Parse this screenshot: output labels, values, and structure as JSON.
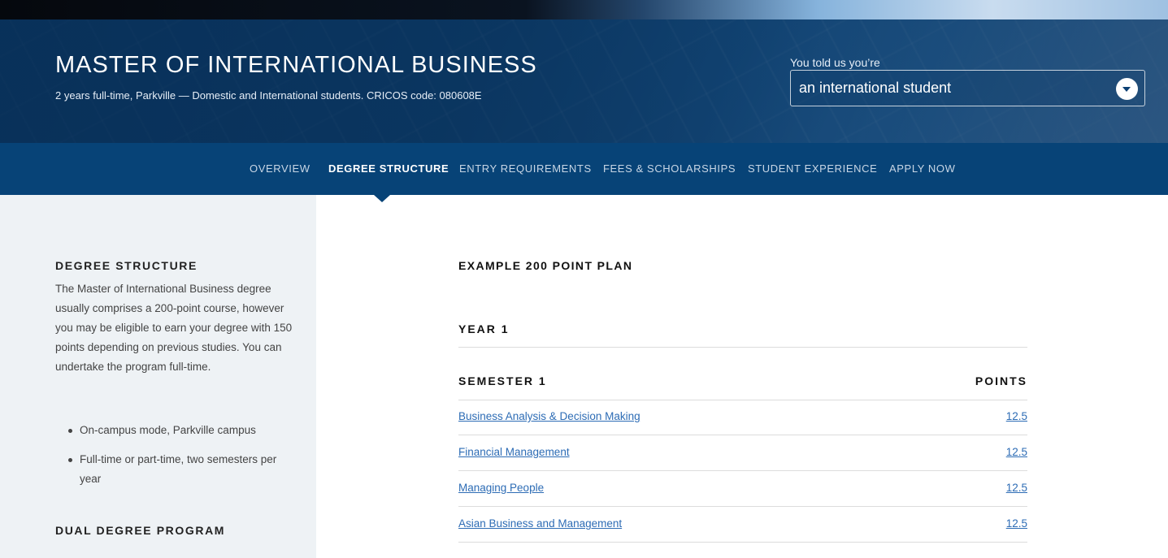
{
  "hero": {
    "title": "MASTER OF INTERNATIONAL BUSINESS",
    "subtitle": "2 years full-time, Parkville — Domestic and International students. CRICOS code: 080608E",
    "told_label": "You told us you’re",
    "student_type": "an international student",
    "dropdown_icon": "chevron-down-icon"
  },
  "nav": {
    "items": [
      {
        "label": "OVERVIEW"
      },
      {
        "label": "DEGREE STRUCTURE"
      },
      {
        "label": "ENTRY REQUIREMENTS"
      },
      {
        "label": "FEES & SCHOLARSHIPS"
      },
      {
        "label": "STUDENT EXPERIENCE"
      },
      {
        "label": "APPLY NOW"
      }
    ],
    "active": "DEGREE STRUCTURE"
  },
  "sidebar": {
    "heading": "DEGREE STRUCTURE",
    "paragraph": " The Master of International Business degree usually comprises a 200-point course, however you may be eligible to earn your degree with 150 points depending on previous studies. You can undertake the program full-time.",
    "bullets": [
      "On-campus mode, Parkville campus",
      "Full-time or part-time, two semesters per year"
    ],
    "heading2": "DUAL DEGREE PROGRAM"
  },
  "main": {
    "plan_heading": "EXAMPLE 200 POINT PLAN",
    "year_heading": "YEAR 1",
    "semester_heading": "SEMESTER 1",
    "points_heading": "POINTS",
    "subjects": [
      {
        "name": "Business Analysis & Decision Making",
        "points": "12.5"
      },
      {
        "name": "Financial Management",
        "points": "12.5"
      },
      {
        "name": "Managing People",
        "points": "12.5"
      },
      {
        "name": "Asian Business and Management",
        "points": "12.5"
      }
    ]
  },
  "colors": {
    "hero_blue": "#0b3f73",
    "nav_blue": "#074377",
    "sidebar_bg": "#eef2f5",
    "link": "#2d6cb5"
  }
}
